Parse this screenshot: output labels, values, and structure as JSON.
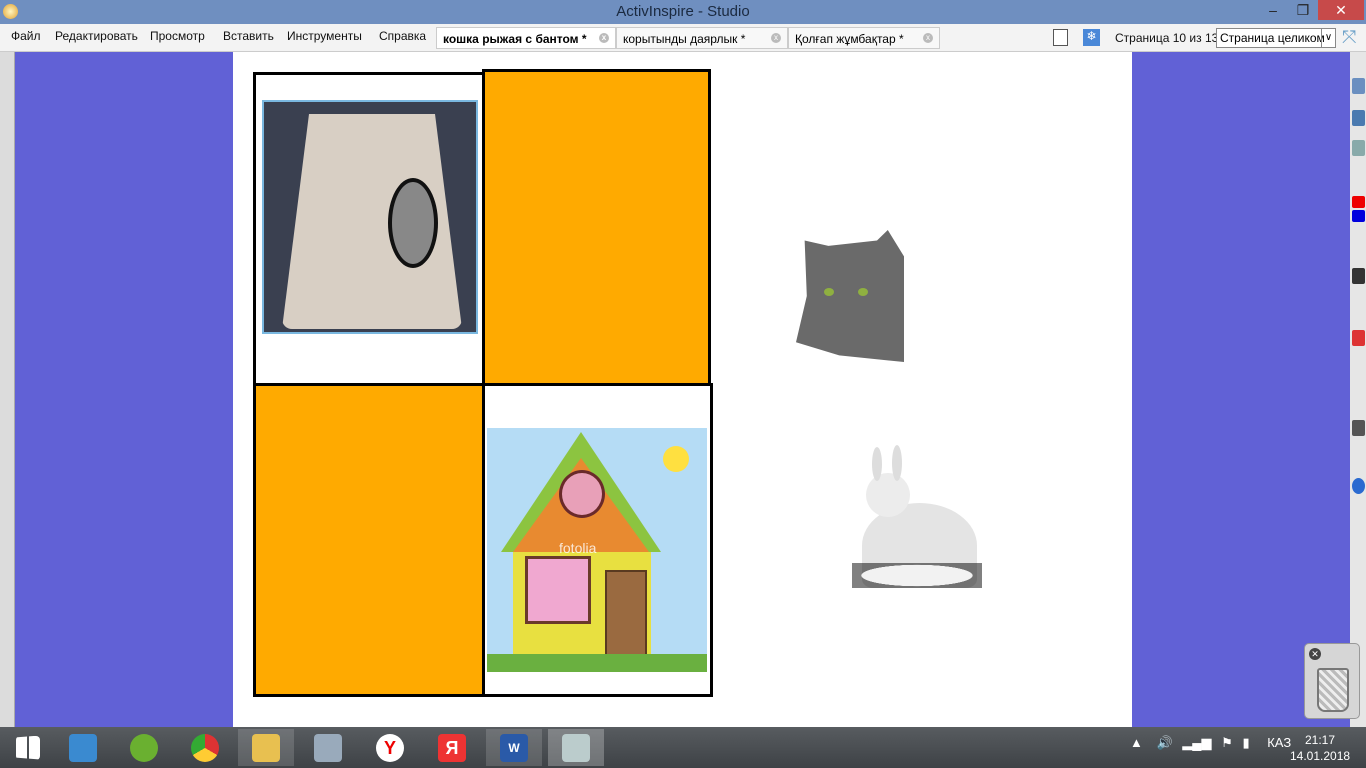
{
  "window": {
    "title": "ActivInspire - Studio"
  },
  "menu": [
    "Файл",
    "Редактировать",
    "Просмотр",
    "Вставить",
    "Инструменты",
    "Справка"
  ],
  "tabs": [
    {
      "label": "кошка рыжая с бантом *",
      "active": true
    },
    {
      "label": "корытынды даярлык *"
    },
    {
      "label": "Қолғап жұмбақтар *"
    }
  ],
  "page_indicator": "Страница 10 из 13",
  "zoom_select": "Страница целиком",
  "watermark": "fotolia",
  "tray": {
    "lang": "КАЗ",
    "time": "21:17",
    "date": "14.01.2018"
  },
  "colors": {
    "orange": "#ffaa00",
    "desktop": "#6161d6"
  }
}
